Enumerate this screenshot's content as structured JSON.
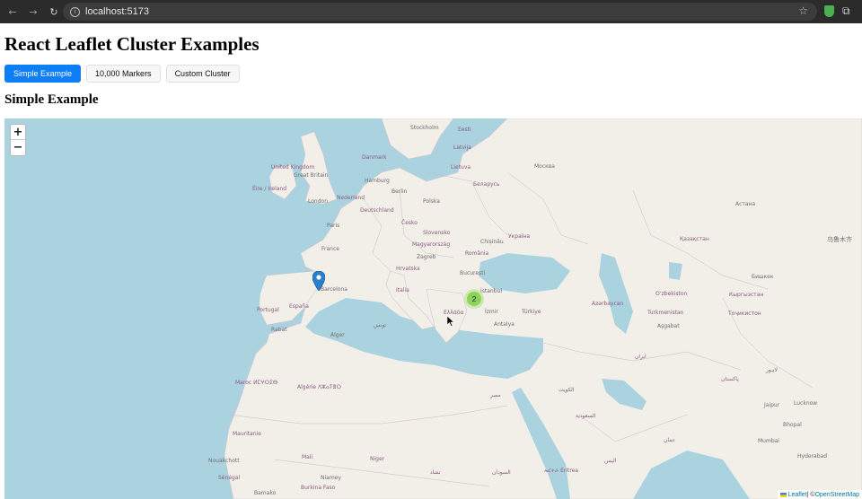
{
  "browser": {
    "url": "localhost:5173",
    "icons": [
      "back-arrow-icon",
      "forward-arrow-icon",
      "reload-icon",
      "info-icon",
      "star-icon",
      "extension-shield-icon",
      "puzzle-icon"
    ]
  },
  "page": {
    "title": "React Leaflet Cluster Examples",
    "tabs": [
      {
        "label": "Simple Example",
        "active": true
      },
      {
        "label": "10,000 Markers",
        "active": false
      },
      {
        "label": "Custom Cluster",
        "active": false
      }
    ],
    "section_title": "Simple Example"
  },
  "map": {
    "zoom_in": "+",
    "zoom_out": "−",
    "cluster_count": "2",
    "labels": {
      "stockholm": "Stockholm",
      "eesti": "Eesti",
      "latvija": "Latvija",
      "danmark": "Danmark",
      "lietuva": "Lietuva",
      "moskva": "Москва",
      "united_kingdom": "United Kingdom",
      "great_britain": "Great Britain",
      "hamburg": "Hamburg",
      "belarus": "Беларусь",
      "eire": "Éire / Ireland",
      "nederland": "Nederland",
      "berlin": "Berlin",
      "polska": "Polska",
      "london": "London",
      "deutschland": "Deutschland",
      "astana": "Астана",
      "paris": "Paris",
      "cesko": "Česko",
      "slovensko": "Slovensko",
      "ukraina": "Україна",
      "france": "France",
      "magyarorszag": "Magyarország",
      "chisinau": "Chișinău",
      "kazakhstan": "Қазақстан",
      "zagreb": "Zagreb",
      "romania": "România",
      "urumqi": "乌鲁木齐",
      "hrvatska": "Hrvatska",
      "bucuresti": "București",
      "bishkek": "Бишкек",
      "italia": "Italia",
      "istanbul": "İstanbul",
      "barcelona": "Barcelona",
      "ozbekiston": "Oʻzbekiston",
      "kyrgyzstan": "Кыргызстан",
      "portugal": "Portugal",
      "espana": "España",
      "azerbaycan": "Azərbaycan",
      "izmir": "İzmir",
      "turkiye": "Türkiye",
      "turkmenistan": "Turkmenistan",
      "tojikiston": "Тоҷикистон",
      "ellada": "Ελλάδα",
      "antalya": "Antalya",
      "asgabat": "Aşgabat",
      "rabat": "Rabat",
      "alger": "Alger",
      "tunis": "تونس",
      "maroc": "Maroc ⵍⵎⵖⵔⵉⴱ",
      "algerie": "Algérie ⴷⵣⴰⵢⴻⵔ",
      "misr": "مصر",
      "saudi": "السعودية",
      "lahore": "لاہور",
      "pakistan": "پاکستان",
      "kuwait": "الكويت",
      "iran": "ایران",
      "jaipur": "Jaipur",
      "lucknow": "Lucknow",
      "bhopal": "Bhopal",
      "mauritanie": "Mauritanie",
      "mali": "Mali",
      "niger": "Niger",
      "tchad": "تشاد",
      "sudan": "السودان",
      "eritrea": "ኤርትራ Eritrea",
      "yemen": "اليمن",
      "oman": "عمان",
      "mumbai": "Mumbai",
      "hyderabad": "Hyderabad",
      "nouakchott": "Nouakchott",
      "senegal": "Sénégal",
      "niamey": "Niamey",
      "burkina": "Burkina Faso",
      "bamako": "Bamako"
    }
  },
  "attribution": {
    "leaflet": "Leaflet",
    "separator": " | © ",
    "osm": "OpenStreetMap"
  }
}
